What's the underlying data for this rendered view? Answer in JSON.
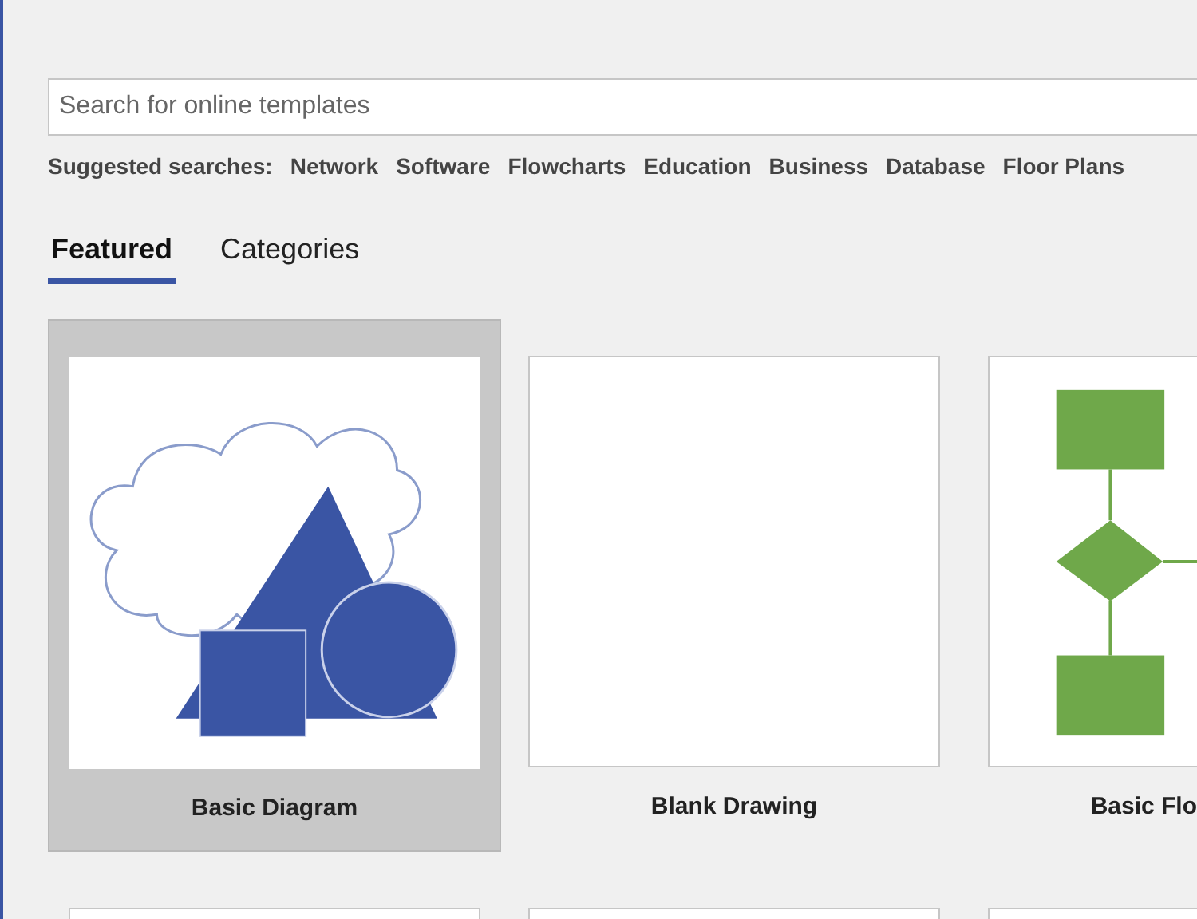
{
  "search": {
    "placeholder": "Search for online templates"
  },
  "suggested": {
    "label": "Suggested searches:",
    "links": [
      "Network",
      "Software",
      "Flowcharts",
      "Education",
      "Business",
      "Database",
      "Floor Plans"
    ]
  },
  "tabs": [
    {
      "label": "Featured",
      "selected": true
    },
    {
      "label": "Categories",
      "selected": false
    }
  ],
  "templates": [
    {
      "name": "Basic Diagram",
      "kind": "shapes",
      "selected": true
    },
    {
      "name": "Blank Drawing",
      "kind": "blank",
      "selected": false
    },
    {
      "name": "Basic Flo",
      "kind": "flowchart",
      "selected": false
    },
    {
      "kind": "blank",
      "selected": false
    },
    {
      "kind": "blank",
      "selected": false
    },
    {
      "kind": "blank",
      "selected": false
    }
  ]
}
